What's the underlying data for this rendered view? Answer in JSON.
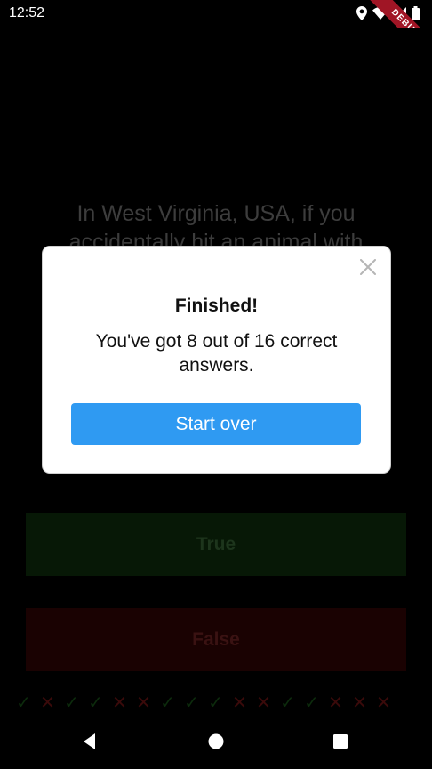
{
  "status": {
    "time": "12:52",
    "debug_label": "DEBUG",
    "icons": [
      "location-icon",
      "wifi-icon",
      "signal-icon",
      "battery-icon"
    ]
  },
  "quiz": {
    "question": "In West Virginia, USA, if you accidentally hit an animal with",
    "true_label": "True",
    "false_label": "False",
    "score_marks": [
      "correct",
      "wrong",
      "correct",
      "correct",
      "wrong",
      "wrong",
      "correct",
      "correct",
      "correct",
      "wrong",
      "wrong",
      "correct",
      "correct",
      "wrong",
      "wrong",
      "wrong"
    ]
  },
  "dialog": {
    "title": "Finished!",
    "message": "You've got 8 out of 16 correct answers.",
    "button_label": "Start over",
    "close_icon": "close-icon"
  },
  "colors": {
    "accent": "#2f9af2",
    "true_bg": "#071806",
    "false_bg": "#1a0202",
    "ribbon": "#a01525"
  },
  "nav": {
    "icons": [
      "back-icon",
      "home-icon",
      "recents-icon"
    ]
  }
}
